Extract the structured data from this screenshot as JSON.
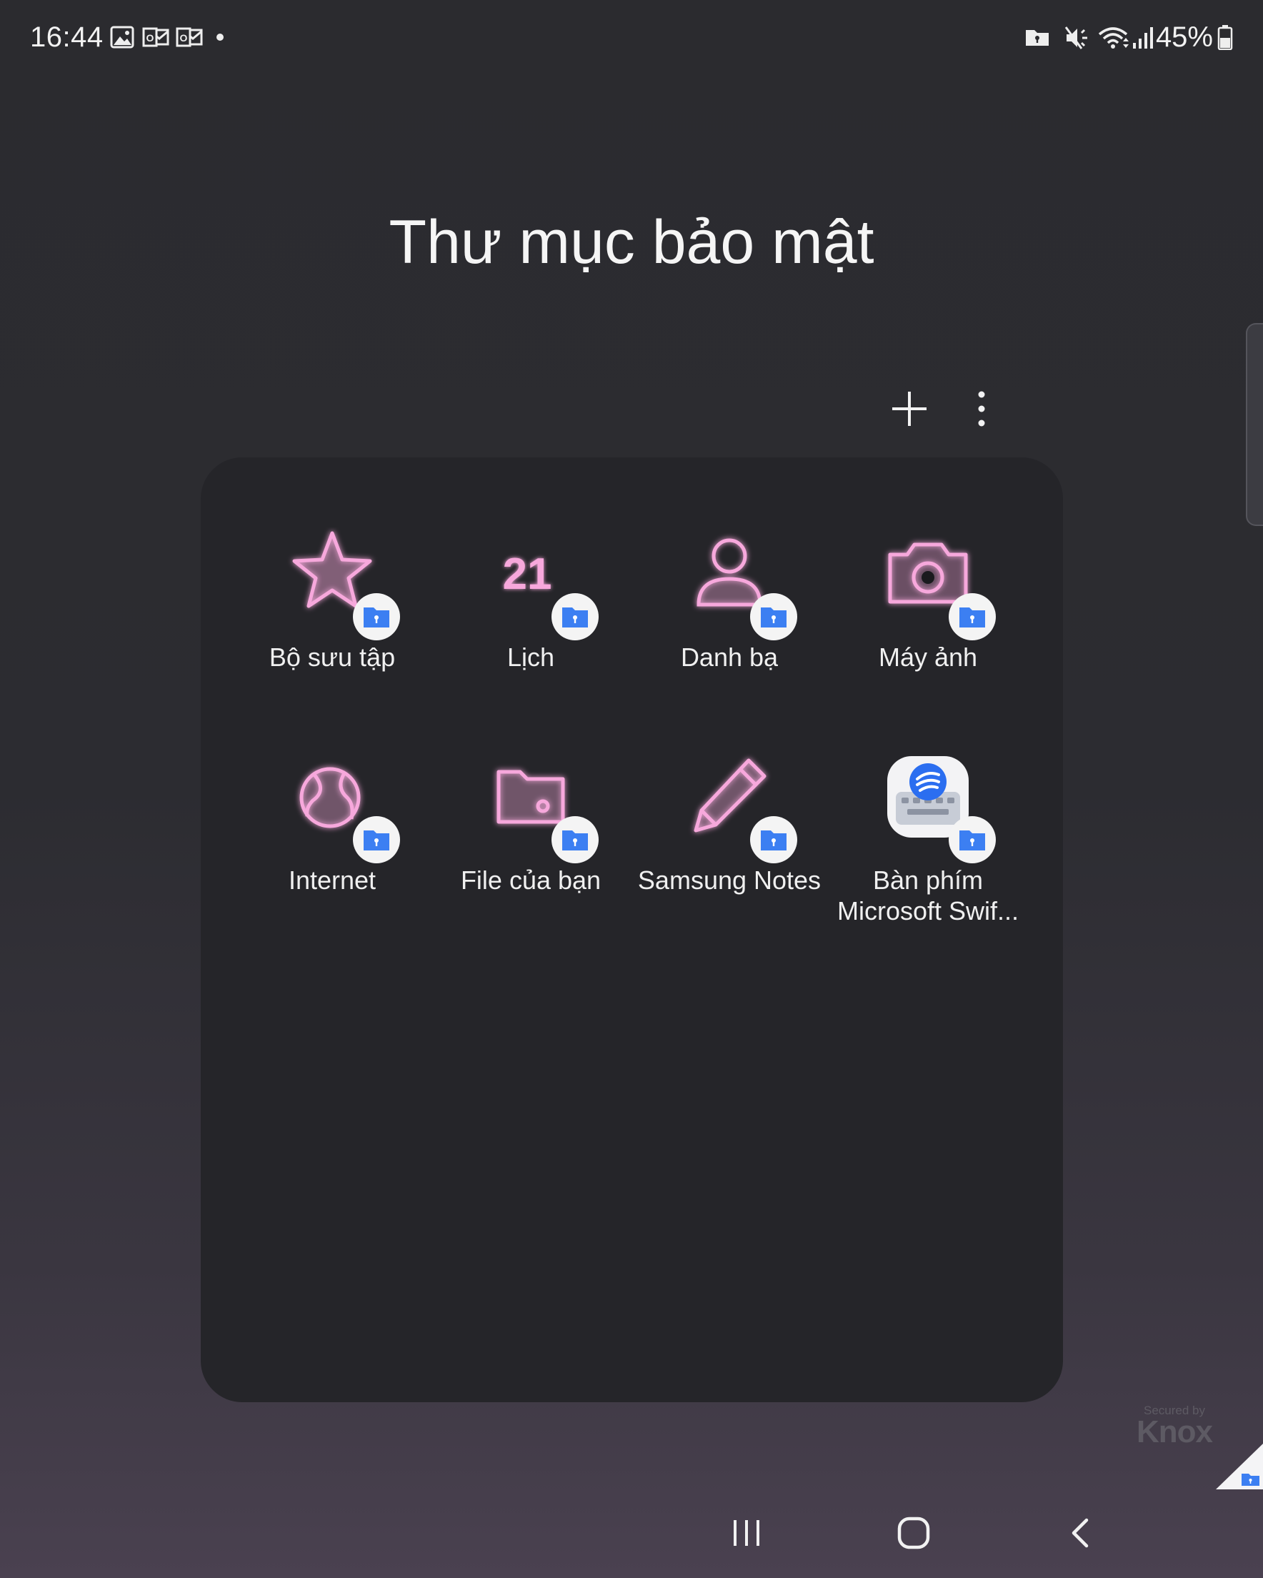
{
  "status_bar": {
    "time": "16:44",
    "battery": "45%"
  },
  "page_title": "Thư mục bảo mật",
  "apps": [
    {
      "label": "Bộ sưu tập",
      "icon": "star-icon"
    },
    {
      "label": "Lịch",
      "icon": "calendar-icon",
      "icon_text": "21"
    },
    {
      "label": "Danh bạ",
      "icon": "contact-icon"
    },
    {
      "label": "Máy ảnh",
      "icon": "camera-icon"
    },
    {
      "label": "Internet",
      "icon": "globe-icon"
    },
    {
      "label": "File của bạn",
      "icon": "folder-icon"
    },
    {
      "label": "Samsung Notes",
      "icon": "pencil-icon"
    },
    {
      "label": "Bàn phím Microsoft Swif...",
      "line1": "Bàn phím",
      "line2": "Microsoft Swif...",
      "icon": "swiftkey-icon"
    }
  ],
  "knox": {
    "line1": "Secured by",
    "line2": "Knox"
  },
  "colors": {
    "neon_pink": "#f7a8dc",
    "badge_blue": "#3c7ff2",
    "panel": "#252529"
  }
}
